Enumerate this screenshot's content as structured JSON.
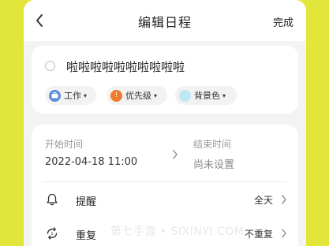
{
  "header": {
    "title": "编辑日程",
    "done_label": "完成"
  },
  "task": {
    "title": "啦啦啦啦啦啦啦啦啦啦",
    "chips": [
      {
        "label": "工作",
        "icon": "briefcase-icon",
        "color": "#5a8de0"
      },
      {
        "label": "优先级",
        "icon": "exclamation-icon",
        "color": "#f07a2a"
      },
      {
        "label": "背景色",
        "icon": "color-dot-icon",
        "color": "#bfe6f5"
      }
    ]
  },
  "time": {
    "start_label": "开始时间",
    "start_value": "2022-04-18 11:00",
    "end_label": "结束时间",
    "end_value": "尚未设置"
  },
  "rows": [
    {
      "label": "提醒",
      "value": "全天",
      "icon": "bell-icon"
    },
    {
      "label": "重复",
      "value": "不重复",
      "icon": "repeat-icon"
    }
  ],
  "watermark": "第七手游 • SIXINYI.COM",
  "colors": {
    "background": "#e2e63a",
    "priority": "#f07a2a",
    "work": "#5a8de0"
  }
}
